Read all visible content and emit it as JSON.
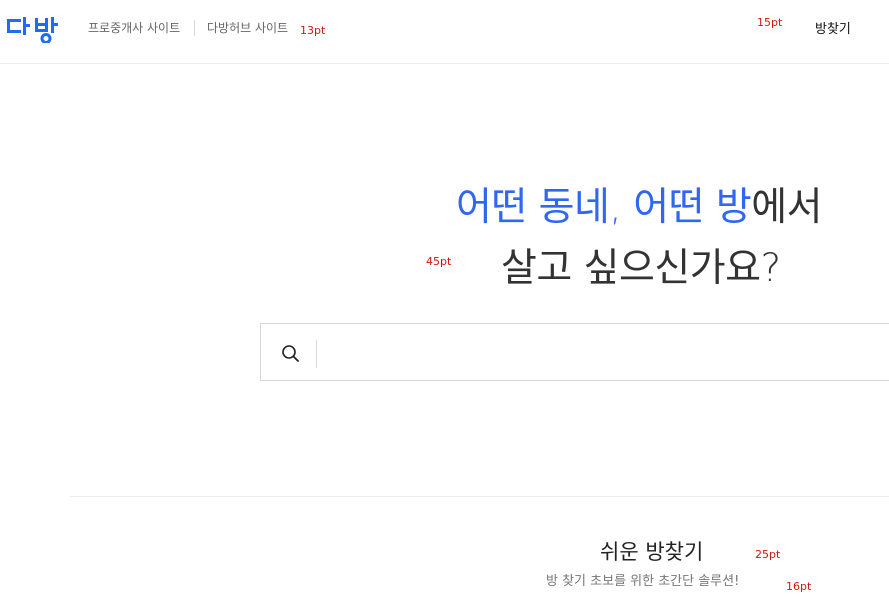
{
  "header": {
    "logo_text": "다방",
    "nav_links": [
      "프로중개사 사이트",
      "다방허브 사이트"
    ],
    "find_room": "방찾기"
  },
  "hero": {
    "line1_blue_a": "어떤 동네,",
    "line1_blue_b": "어떤 방",
    "line1_rest": "에서",
    "line2": "살고 싶으신가요?"
  },
  "search": {
    "placeholder": "",
    "value": ""
  },
  "section": {
    "title": "쉬운 방찾기",
    "subtitle": "방 찾기 초보를 위한 초간단 솔루션!"
  },
  "annotations": {
    "nav_size": "13pt",
    "find_size": "15pt",
    "hero_size": "45pt",
    "title_size": "25pt",
    "subtitle_size": "16pt"
  },
  "colors": {
    "brand_blue": "#3067f2",
    "text_dark": "#333333",
    "annotation_red": "#d4150b"
  }
}
